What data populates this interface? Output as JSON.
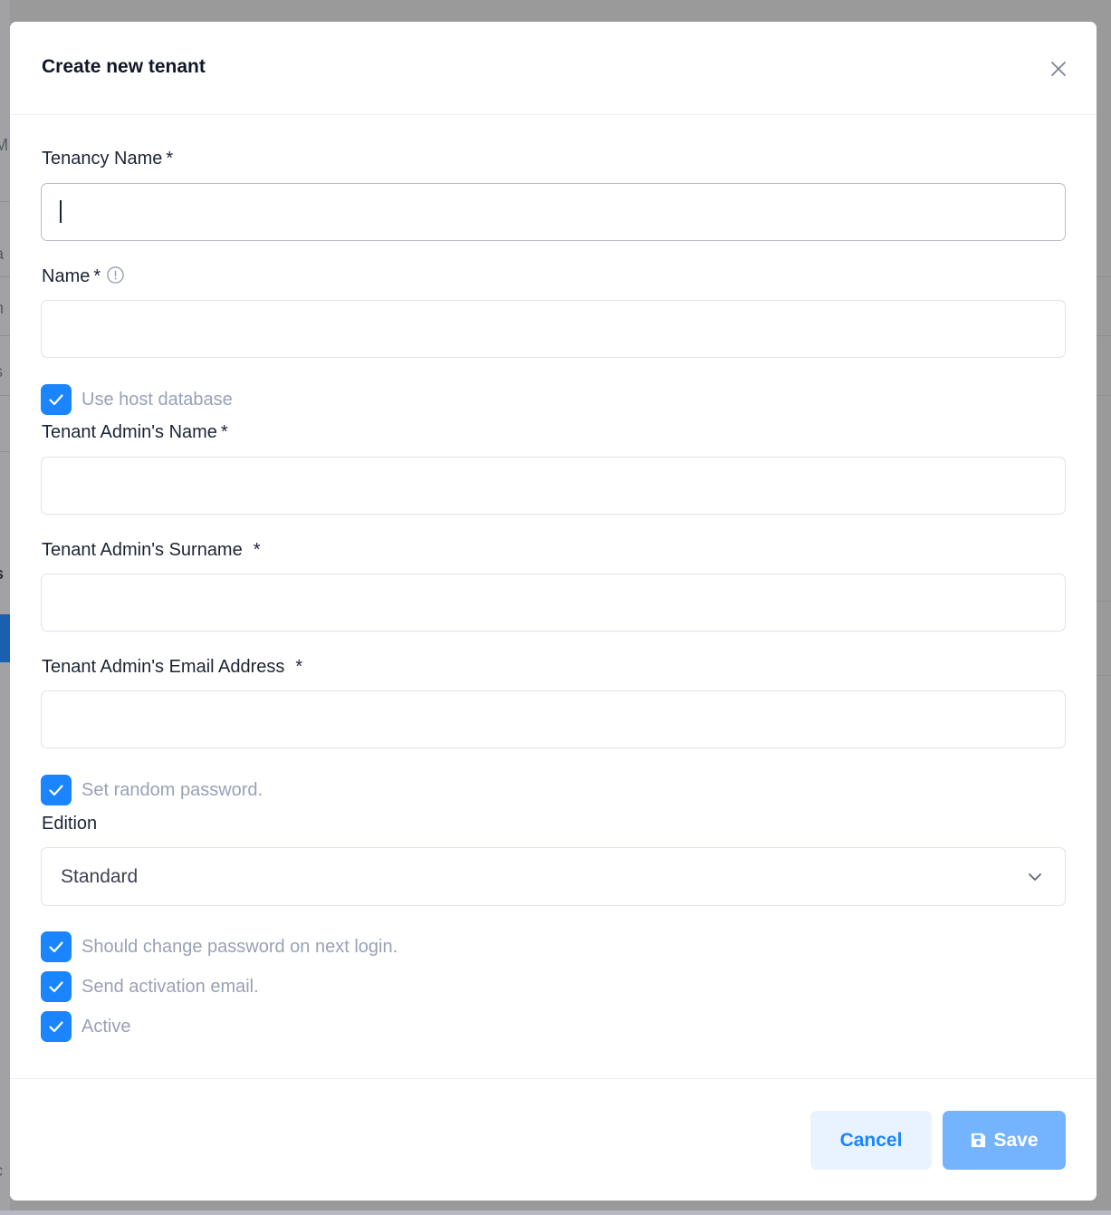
{
  "background": {
    "fragments": [
      "M",
      "a",
      "n",
      "s",
      "/",
      "s",
      "c"
    ]
  },
  "modal": {
    "title": "Create new tenant",
    "close_icon": "close-icon"
  },
  "form": {
    "tenancy_name": {
      "label": "Tenancy Name",
      "required_mark": "*",
      "value": ""
    },
    "name": {
      "label": "Name",
      "required_mark": "*",
      "info_icon": "info-circle-icon",
      "value": ""
    },
    "use_host_database": {
      "label": "Use host database",
      "checked": true
    },
    "admin_name": {
      "label": "Tenant Admin's Name",
      "required_mark": "*",
      "value": ""
    },
    "admin_surname": {
      "label": "Tenant Admin's Surname",
      "required_mark": "*",
      "value": ""
    },
    "admin_email": {
      "label": "Tenant Admin's Email Address",
      "required_mark": "*",
      "value": ""
    },
    "set_random_password": {
      "label": "Set random password.",
      "checked": true
    },
    "edition": {
      "label": "Edition",
      "selected": "Standard",
      "chevron_icon": "chevron-down-icon"
    },
    "should_change_password": {
      "label": "Should change password on next login.",
      "checked": true
    },
    "send_activation_email": {
      "label": "Send activation email.",
      "checked": true
    },
    "active": {
      "label": "Active",
      "checked": true
    }
  },
  "footer": {
    "cancel_label": "Cancel",
    "save_label": "Save",
    "save_icon": "floppy-disk-icon"
  },
  "colors": {
    "accent": "#1b84ff",
    "save_button": "#74b4ff",
    "cancel_button_bg": "#e9f3ff",
    "checkbox_label": "#99a1b7",
    "overlay": "#9a9a9a"
  }
}
